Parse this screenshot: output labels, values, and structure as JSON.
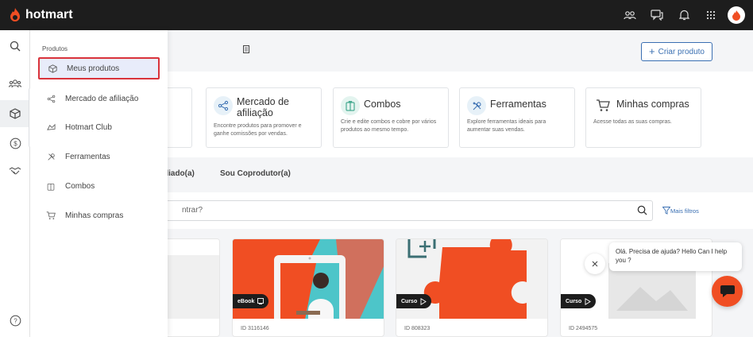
{
  "brand": {
    "name": "hotmart",
    "color": "#f04e23"
  },
  "topbar": {
    "icons": [
      "community-icon",
      "chat-icon",
      "bell-icon",
      "apps-grid-icon",
      "avatar"
    ]
  },
  "rail": {
    "icons": [
      "search-icon",
      "people-icon",
      "box-icon",
      "dollar-icon",
      "handshake-icon",
      "help-icon"
    ]
  },
  "menu": {
    "section": "Produtos",
    "items": [
      {
        "label": "Meus produtos",
        "icon": "box-icon"
      },
      {
        "label": "Mercado de afiliação",
        "icon": "network-icon"
      },
      {
        "label": "Hotmart Club",
        "icon": "club-icon"
      },
      {
        "label": "Ferramentas",
        "icon": "tools-icon"
      },
      {
        "label": "Combos",
        "icon": "combo-icon"
      },
      {
        "label": "Minhas compras",
        "icon": "cart-icon"
      }
    ]
  },
  "header": {
    "create_label": "Criar produto"
  },
  "cards": [
    {
      "title": "",
      "desc": "o"
    },
    {
      "title": "Mercado de afiliação",
      "desc": "Encontre produtos para promover e ganhe comissões por vendas."
    },
    {
      "title": "Combos",
      "desc": "Crie e edite combos e cobre por vários produtos ao mesmo tempo."
    },
    {
      "title": "Ferramentas",
      "desc": "Explore ferramentas ideais para aumentar suas vendas."
    },
    {
      "title": "Minhas compras",
      "desc": "Acesse todas as suas compras."
    }
  ],
  "tabs": [
    "Afiliado(a)",
    "Sou Coprodutor(a)"
  ],
  "search": {
    "placeholder": "ntrar?",
    "filters_label": "Mais filtros"
  },
  "products": [
    {
      "id": "",
      "badge": ""
    },
    {
      "id": "ID 3116146",
      "badge": "eBook"
    },
    {
      "id": "ID 808323",
      "badge": "Curso"
    },
    {
      "id": "ID 2494575",
      "badge": "Curso"
    }
  ],
  "chat": {
    "message": "Olá. Precisa de ajuda? Hello Can I help you ?"
  },
  "colors": {
    "accent": "#3a6fb2",
    "topbar": "#1d1d1d",
    "orange": "#f04e23",
    "teal": "#4dc5c9"
  }
}
